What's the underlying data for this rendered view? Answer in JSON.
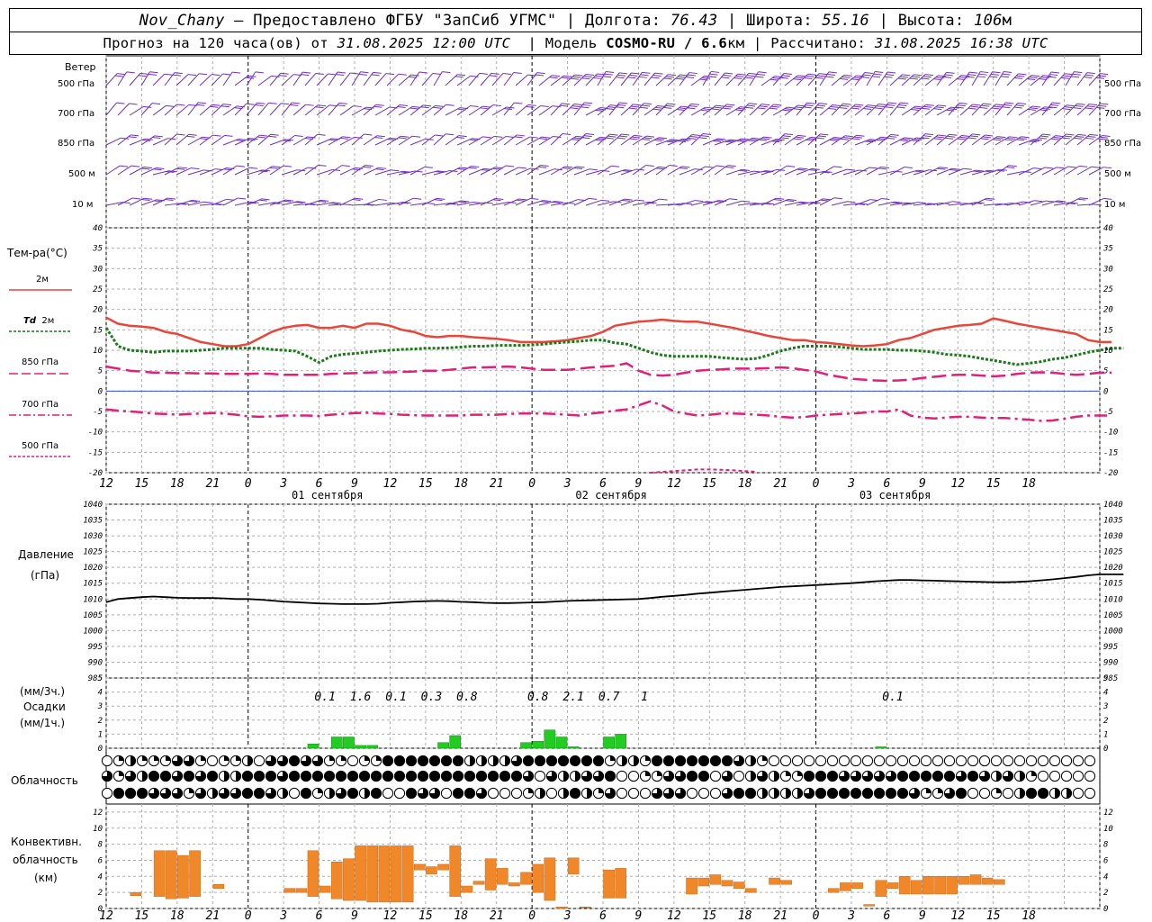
{
  "header": {
    "station": "Nov_Chany",
    "provider": "– Предоставлено ФГБУ \"ЗапСиб УГМС\" |",
    "lon_label": "Долгота:",
    "lon_value": "76.43",
    "lat_label": "| Широта:",
    "lat_value": "55.16",
    "alt_label": "| Высота:",
    "alt_value": "106",
    "alt_unit": "м",
    "forecast_prefix": "Прогноз на 120 часа(ов) от",
    "forecast_time": "31.08.2025 12:00 UTC",
    "model_label": "| Модель",
    "model_name": "COSMO-RU / 6.6",
    "model_unit": "км",
    "calc_label": "| Рассчитано:",
    "calc_time": "31.08.2025 16:38 UTC"
  },
  "labels": {
    "wind": "Ветер",
    "wind_levels": [
      "500 гПа",
      "700 гПа",
      "850 гПа",
      "500 м",
      "10 м"
    ],
    "temp_title": "Тем-ра(°C)",
    "t2m": "2м",
    "td": "Td",
    "td_2m": "2м",
    "t850": "850 гПа",
    "t700": "700 гПа",
    "t500": "500 гПа",
    "pressure": "Давление",
    "pressure_unit": "(гПа)",
    "precip_unit3": "(мм/3ч.)",
    "precip": "Осадки",
    "precip_unit1": "(мм/1ч.)",
    "clouds": "Облачность",
    "conv1": "Конвективн.",
    "conv2": "облачность",
    "conv3": "(км)"
  },
  "colors": {
    "t2m": "#e8463a",
    "td": "#1a7a1a",
    "t850": "#e0207a",
    "wind": "#7030c0",
    "precip": "#22cc22",
    "conv": "#f0882a",
    "zero": "#3050e0"
  },
  "chart_data": {
    "type": "meteogram",
    "x_hours_labels": [
      "12",
      "15",
      "18",
      "21",
      "0",
      "3",
      "6",
      "9",
      "12",
      "15",
      "18",
      "21",
      "0",
      "3",
      "6",
      "9",
      "12",
      "15",
      "18",
      "21",
      "0",
      "3",
      "6",
      "9",
      "12",
      "15",
      "18"
    ],
    "dates": [
      "01 сентября",
      "02 сентября",
      "03 сентября"
    ],
    "temperature": {
      "ylim": [
        -20,
        40
      ],
      "yticks": [
        -20,
        -15,
        -10,
        -5,
        0,
        5,
        10,
        15,
        20,
        25,
        30,
        35,
        40
      ],
      "t2m": [
        18,
        16.5,
        16,
        15.8,
        15.5,
        14.5,
        14,
        13,
        12,
        11.5,
        11,
        11,
        11.5,
        13,
        14.5,
        15.5,
        16,
        16.2,
        15.5,
        15.5,
        16,
        15.5,
        16.5,
        16.5,
        16,
        15,
        14.5,
        13.5,
        13.2,
        13.5,
        13.5,
        13.2,
        13,
        12.8,
        12.5,
        12,
        12,
        12,
        12.2,
        12.5,
        13,
        13.5,
        14.5,
        16,
        16.5,
        17,
        17.2,
        17.5,
        17.2,
        17,
        17,
        16.5,
        16,
        15.5,
        14.8,
        14.2,
        13.5,
        13,
        12.5,
        12.5,
        12,
        11.8,
        11.5,
        11.2,
        11,
        11.2,
        11.5,
        12.5,
        13,
        14,
        15,
        15.5,
        16,
        16.2,
        16.5,
        17.8,
        17.2,
        16.5,
        16,
        15.5,
        15,
        14.5,
        14,
        12.5,
        12,
        12
      ],
      "td": [
        15.5,
        11,
        10,
        9.8,
        9.5,
        9.8,
        9.8,
        9.8,
        10,
        10.2,
        10.5,
        10.5,
        10.5,
        10.5,
        10.2,
        10,
        9.8,
        8.5,
        7,
        8.5,
        9,
        9.2,
        9.5,
        9.8,
        10,
        10.2,
        10.3,
        10.5,
        10.5,
        10.6,
        10.8,
        11,
        11,
        11.2,
        11.2,
        11.2,
        11.3,
        11.5,
        11.8,
        12,
        12.2,
        12.5,
        12.5,
        11.8,
        11.5,
        10.5,
        9.5,
        8.8,
        8.5,
        8.5,
        8.5,
        8.5,
        8.2,
        8,
        7.8,
        8,
        8.8,
        9.8,
        10.5,
        11,
        11,
        11,
        10.8,
        10.5,
        10.2,
        10.2,
        10.2,
        10,
        10,
        9.8,
        9.5,
        9,
        8.8,
        8.5,
        8,
        7.5,
        7,
        6.5,
        6.8,
        7.2,
        7.8,
        8.2,
        8.8,
        9.5,
        10,
        10.5,
        10.5
      ],
      "t850": [
        6,
        5.5,
        5,
        4.8,
        4.5,
        4.5,
        4.4,
        4.4,
        4.3,
        4.3,
        4.2,
        4.2,
        4.2,
        4.3,
        4.2,
        4,
        4,
        4,
        4,
        4.2,
        4.3,
        4.4,
        4.5,
        4.6,
        4.6,
        4.7,
        4.8,
        5,
        5,
        5.2,
        5.5,
        5.8,
        5.8,
        5.9,
        6,
        5.8,
        5.5,
        5.2,
        5.2,
        5.2,
        5.5,
        5.8,
        6,
        6.2,
        6.8,
        5,
        4,
        3.8,
        4,
        4.5,
        5,
        5.2,
        5.3,
        5.5,
        5.5,
        5.5,
        5.6,
        5.8,
        5.6,
        5.2,
        4.8,
        4,
        3.5,
        3,
        2.8,
        2.6,
        2.5,
        2.6,
        2.8,
        3.2,
        3.5,
        3.8,
        4,
        4,
        3.8,
        3.6,
        3.8,
        4.2,
        4.5,
        4.6,
        4.5,
        4.2,
        4,
        4.2,
        4.5,
        4.5
      ],
      "t700": [
        -4.5,
        -4.8,
        -5,
        -5.2,
        -5.5,
        -5.6,
        -5.8,
        -5.6,
        -5.5,
        -5.4,
        -5.5,
        -5.8,
        -6.2,
        -6.3,
        -6.2,
        -6,
        -6,
        -6,
        -6.1,
        -5.8,
        -5.6,
        -5.4,
        -5.3,
        -5.5,
        -5.6,
        -5.8,
        -5.9,
        -6,
        -6,
        -6,
        -6,
        -5.8,
        -5.8,
        -5.8,
        -5.6,
        -5.5,
        -5.5,
        -5.5,
        -5.6,
        -5.8,
        -6,
        -5.5,
        -5.2,
        -4.8,
        -4.5,
        -3.5,
        -2.5,
        -3.5,
        -5,
        -5.5,
        -6,
        -5.8,
        -5.5,
        -5.5,
        -5.6,
        -5.8,
        -6,
        -6.3,
        -6.5,
        -6.4,
        -6,
        -5.8,
        -5.6,
        -5.5,
        -5.3,
        -5,
        -5,
        -4.5,
        -6,
        -6.5,
        -6.7,
        -6.5,
        -6.3,
        -6.3,
        -6.5,
        -6.6,
        -6.6,
        -6.8,
        -7,
        -7.3,
        -7.2,
        -6.8,
        -6.3,
        -6,
        -6,
        -6
      ],
      "t500_start": 46,
      "t500": [
        -20,
        -19.8,
        -19.6,
        -19.4,
        -19.2,
        -19.2,
        -19.3,
        -19.4,
        -19.6,
        -19.8
      ]
    },
    "pressure": {
      "ylim": [
        985,
        1040
      ],
      "yticks": [
        985,
        990,
        995,
        1000,
        1005,
        1010,
        1015,
        1020,
        1025,
        1030,
        1035,
        1040
      ],
      "values": [
        1009,
        1010,
        1010.3,
        1010.6,
        1010.8,
        1010.6,
        1010.4,
        1010.3,
        1010.3,
        1010.3,
        1010.2,
        1010,
        1010,
        1009.8,
        1009.5,
        1009.2,
        1009,
        1008.8,
        1008.6,
        1008.5,
        1008.4,
        1008.4,
        1008.4,
        1008.5,
        1008.8,
        1009,
        1009.2,
        1009.3,
        1009.4,
        1009.3,
        1009.1,
        1009,
        1008.8,
        1008.7,
        1008.7,
        1008.8,
        1008.9,
        1009,
        1009.2,
        1009.4,
        1009.5,
        1009.6,
        1009.7,
        1009.8,
        1009.9,
        1010,
        1010.3,
        1010.7,
        1011,
        1011.3,
        1011.7,
        1012,
        1012.3,
        1012.6,
        1012.9,
        1013.2,
        1013.5,
        1013.8,
        1014,
        1014.2,
        1014.4,
        1014.6,
        1014.8,
        1015,
        1015.3,
        1015.6,
        1015.8,
        1016,
        1016,
        1015.9,
        1015.8,
        1015.7,
        1015.6,
        1015.5,
        1015.4,
        1015.3,
        1015.3,
        1015.4,
        1015.6,
        1015.9,
        1016.2,
        1016.6,
        1017,
        1017.5,
        1017.8,
        1017.8,
        1017.8
      ]
    },
    "precip": {
      "ylim": [
        0,
        5
      ],
      "yticks": [
        0,
        1,
        2,
        3,
        4,
        5
      ],
      "totals3h": [
        {
          "h": 18.5,
          "v": "0.1"
        },
        {
          "h": 21.5,
          "v": "1.6"
        },
        {
          "h": 24.5,
          "v": "0.1"
        },
        {
          "h": 27.5,
          "v": "0.3"
        },
        {
          "h": 30.5,
          "v": "0.8"
        },
        {
          "h": 36.5,
          "v": "0.8"
        },
        {
          "h": 39.5,
          "v": "2.1"
        },
        {
          "h": 42.5,
          "v": "0.7"
        },
        {
          "h": 45.5,
          "v": "1"
        },
        {
          "h": 66.5,
          "v": "0.1"
        }
      ],
      "bars": [
        {
          "h": 17,
          "v": 0.3
        },
        {
          "h": 19,
          "v": 0.8
        },
        {
          "h": 20,
          "v": 0.8
        },
        {
          "h": 21,
          "v": 0.2
        },
        {
          "h": 22,
          "v": 0.2
        },
        {
          "h": 28,
          "v": 0.4
        },
        {
          "h": 29,
          "v": 0.9
        },
        {
          "h": 35,
          "v": 0.4
        },
        {
          "h": 36,
          "v": 0.5
        },
        {
          "h": 37,
          "v": 1.3
        },
        {
          "h": 38,
          "v": 0.8
        },
        {
          "h": 39,
          "v": 0.1
        },
        {
          "h": 42,
          "v": 0.8
        },
        {
          "h": 43,
          "v": 1.0
        },
        {
          "h": 65,
          "v": 0.1
        }
      ]
    },
    "conv": {
      "ylim": [
        0,
        13
      ],
      "yticks": [
        0,
        2,
        4,
        6,
        8,
        10,
        12
      ],
      "bars": [
        {
          "h": 2,
          "lo": 1.6,
          "hi": 2.0
        },
        {
          "h": 4,
          "lo": 1.5,
          "hi": 7.2
        },
        {
          "h": 5,
          "lo": 1.2,
          "hi": 7.2
        },
        {
          "h": 6,
          "lo": 1.3,
          "hi": 6.6
        },
        {
          "h": 7,
          "lo": 1.5,
          "hi": 7.2
        },
        {
          "h": 9,
          "lo": 2.5,
          "hi": 3.0
        },
        {
          "h": 15,
          "lo": 2.0,
          "hi": 2.5
        },
        {
          "h": 16,
          "lo": 2.0,
          "hi": 2.5
        },
        {
          "h": 17,
          "lo": 1.5,
          "hi": 7.2
        },
        {
          "h": 18,
          "lo": 2.0,
          "hi": 2.8
        },
        {
          "h": 19,
          "lo": 1.2,
          "hi": 5.8
        },
        {
          "h": 20,
          "lo": 1.0,
          "hi": 6.2
        },
        {
          "h": 21,
          "lo": 1.0,
          "hi": 7.8
        },
        {
          "h": 22,
          "lo": 0.8,
          "hi": 7.8
        },
        {
          "h": 23,
          "lo": 0.8,
          "hi": 7.8
        },
        {
          "h": 24,
          "lo": 0.8,
          "hi": 7.8
        },
        {
          "h": 25,
          "lo": 0.8,
          "hi": 7.8
        },
        {
          "h": 26,
          "lo": 4.8,
          "hi": 5.5
        },
        {
          "h": 27,
          "lo": 4.3,
          "hi": 5.2
        },
        {
          "h": 28,
          "lo": 4.8,
          "hi": 5.5
        },
        {
          "h": 29,
          "lo": 1.5,
          "hi": 7.8
        },
        {
          "h": 30,
          "lo": 2.0,
          "hi": 2.8
        },
        {
          "h": 31,
          "lo": 3.0,
          "hi": 3.4
        },
        {
          "h": 32,
          "lo": 2.3,
          "hi": 6.2
        },
        {
          "h": 33,
          "lo": 3.0,
          "hi": 5.0
        },
        {
          "h": 34,
          "lo": 2.8,
          "hi": 3.2
        },
        {
          "h": 35,
          "lo": 3.0,
          "hi": 4.5
        },
        {
          "h": 36,
          "lo": 2.0,
          "hi": 5.5
        },
        {
          "h": 37,
          "lo": 1.0,
          "hi": 6.3
        },
        {
          "h": 38,
          "lo": 0.0,
          "hi": 0.2
        },
        {
          "h": 39,
          "lo": 4.3,
          "hi": 6.3
        },
        {
          "h": 40,
          "lo": 0.1,
          "hi": 0.2
        },
        {
          "h": 42,
          "lo": 1.3,
          "hi": 4.8
        },
        {
          "h": 43,
          "lo": 1.3,
          "hi": 5.0
        },
        {
          "h": 49,
          "lo": 1.8,
          "hi": 3.8
        },
        {
          "h": 50,
          "lo": 2.8,
          "hi": 3.8
        },
        {
          "h": 51,
          "lo": 3.0,
          "hi": 4.2
        },
        {
          "h": 52,
          "lo": 2.8,
          "hi": 3.5
        },
        {
          "h": 53,
          "lo": 2.5,
          "hi": 3.3
        },
        {
          "h": 54,
          "lo": 2.0,
          "hi": 2.5
        },
        {
          "h": 56,
          "lo": 3.0,
          "hi": 3.8
        },
        {
          "h": 57,
          "lo": 3.0,
          "hi": 3.5
        },
        {
          "h": 61,
          "lo": 2.0,
          "hi": 2.5
        },
        {
          "h": 62,
          "lo": 2.2,
          "hi": 3.2
        },
        {
          "h": 63,
          "lo": 2.5,
          "hi": 3.2
        },
        {
          "h": 64,
          "lo": 0.3,
          "hi": 0.5
        },
        {
          "h": 65,
          "lo": 1.5,
          "hi": 3.5
        },
        {
          "h": 66,
          "lo": 2.5,
          "hi": 3.2
        },
        {
          "h": 67,
          "lo": 1.8,
          "hi": 4.0
        },
        {
          "h": 68,
          "lo": 1.8,
          "hi": 3.5
        },
        {
          "h": 69,
          "lo": 1.8,
          "hi": 4.0
        },
        {
          "h": 70,
          "lo": 1.8,
          "hi": 4.0
        },
        {
          "h": 71,
          "lo": 1.8,
          "hi": 4.0
        },
        {
          "h": 72,
          "lo": 3.0,
          "hi": 4.0
        },
        {
          "h": 73,
          "lo": 3.0,
          "hi": 4.2
        },
        {
          "h": 74,
          "lo": 3.0,
          "hi": 3.8
        },
        {
          "h": 75,
          "lo": 3.0,
          "hi": 3.6
        }
      ]
    },
    "clouds_rows": [
      "01211133101120334331101144444442222344444441221444444432100000000000000000000000000000000",
      "31324434342244434444444444444444444430322334001133440302321144433333444443432321000000000",
      "04443331323344320412342400433044300012024213000333000344222234444444431134001024422000004"
    ]
  }
}
